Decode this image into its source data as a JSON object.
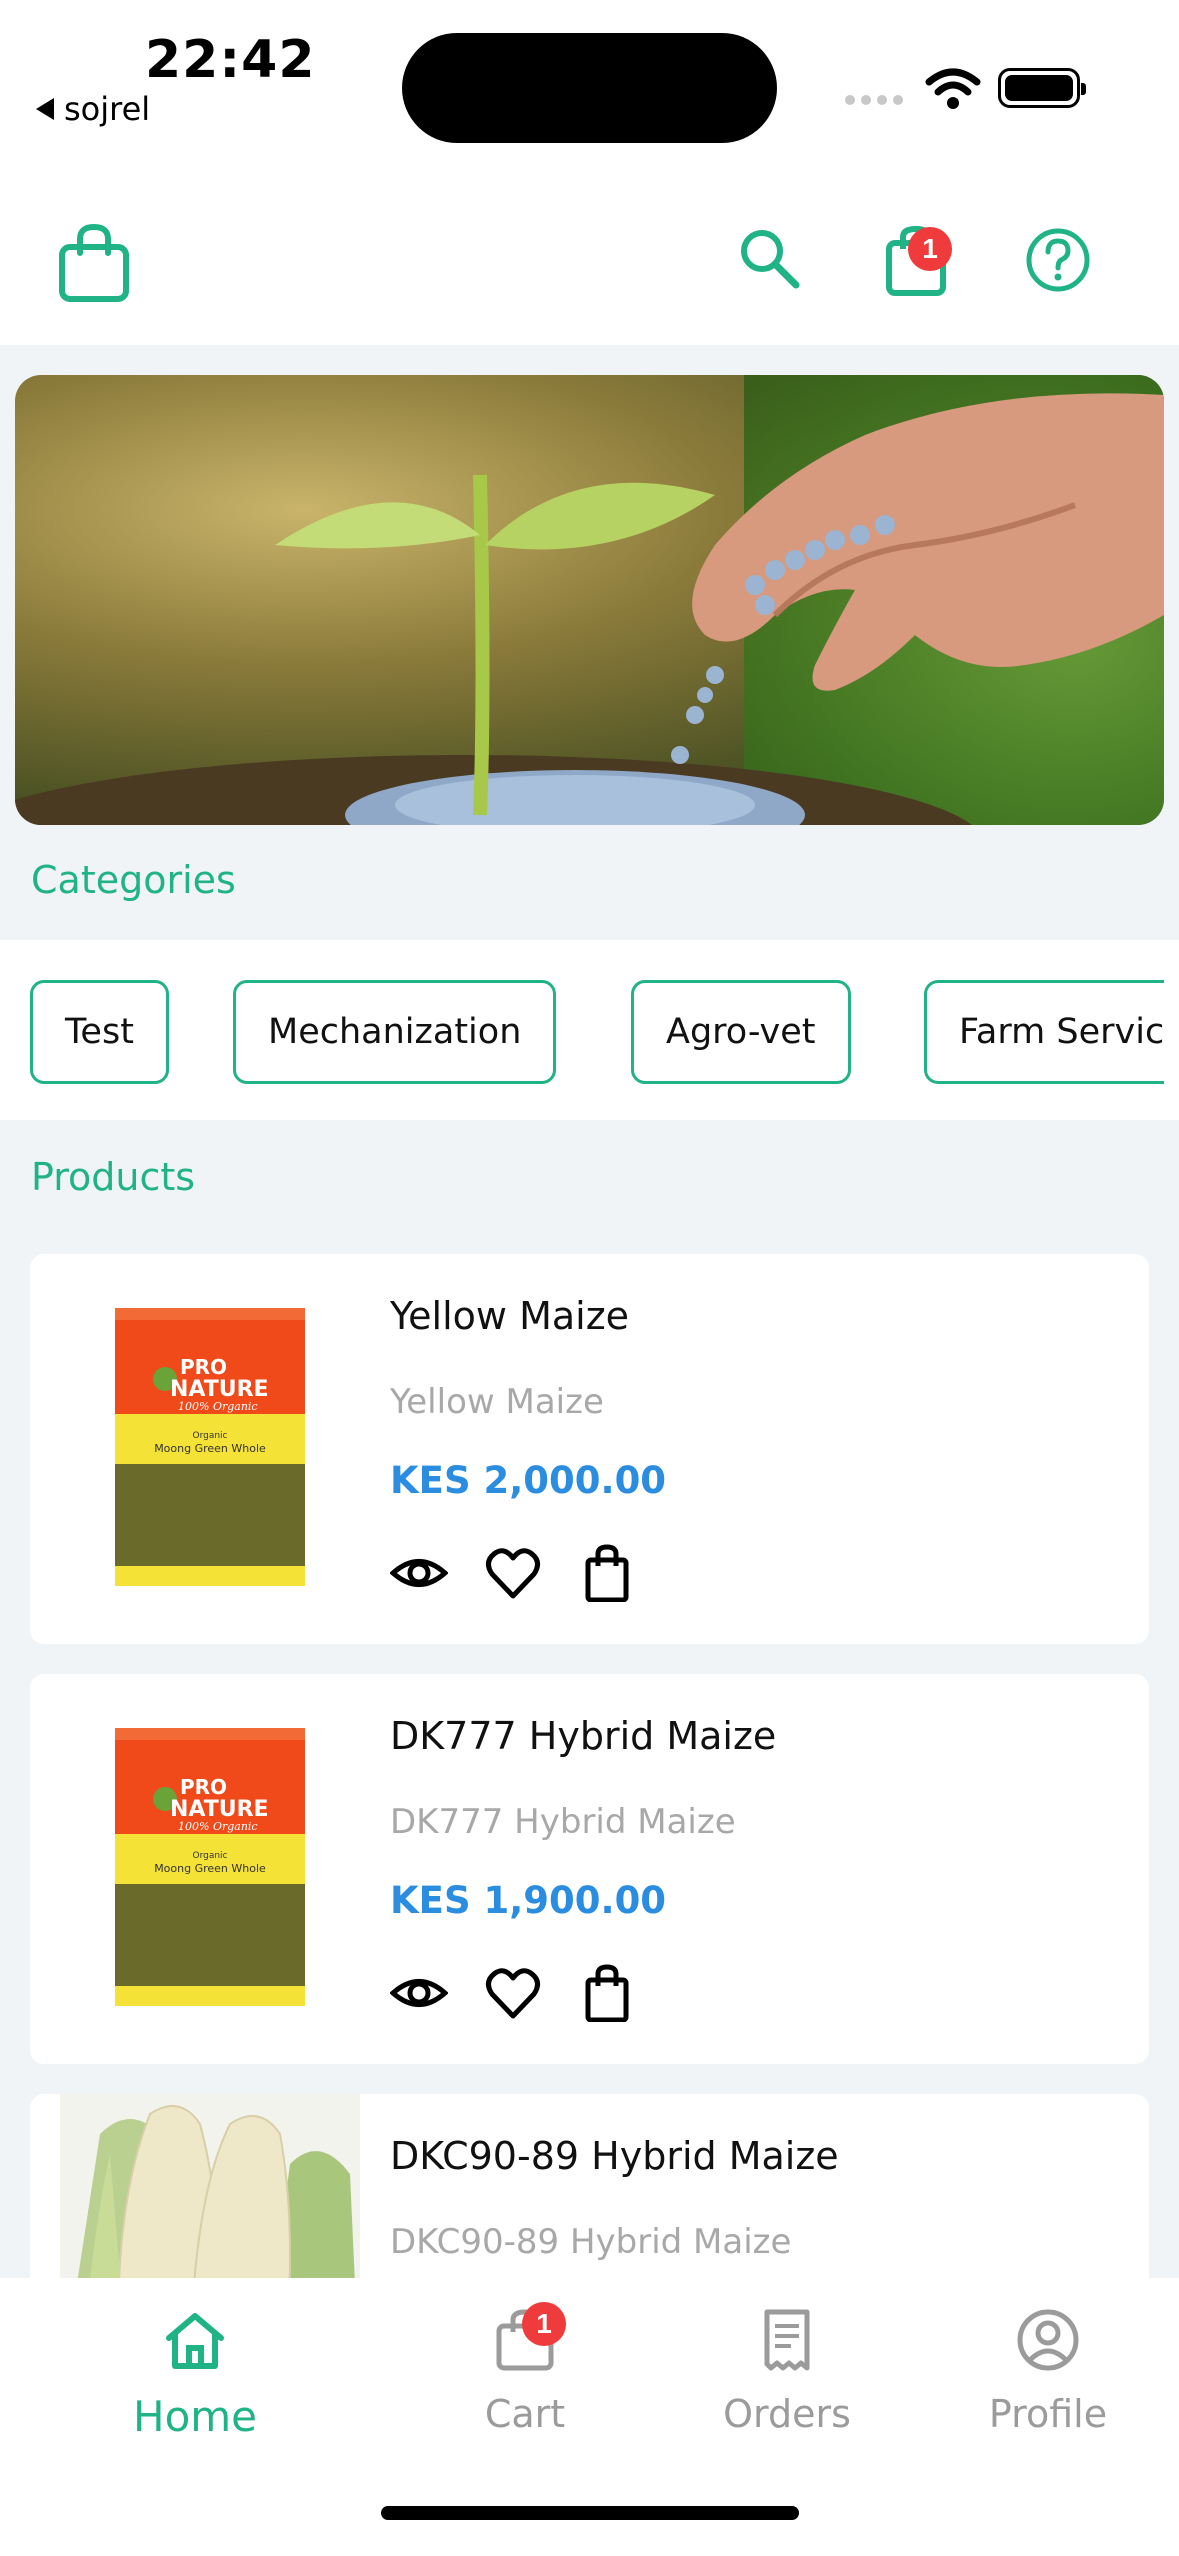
{
  "status_bar": {
    "time": "22:42",
    "back_app": "sojrel"
  },
  "header": {
    "cart_count": "1"
  },
  "categories": {
    "title": "Categories",
    "items": [
      "Test",
      "Mechanization",
      "Agro-vet",
      "Farm Servic"
    ]
  },
  "products": {
    "title": "Products",
    "items": [
      {
        "name": "Yellow Maize",
        "desc": "Yellow Maize",
        "price": "KES 2,000.00"
      },
      {
        "name": "DK777 Hybrid Maize",
        "desc": "DK777 Hybrid Maize",
        "price": "KES 1,900.00"
      },
      {
        "name": "DKC90-89 Hybrid Maize",
        "desc": "DKC90-89 Hybrid Maize",
        "price": ""
      }
    ],
    "packet_brand": [
      "PRO",
      "NATURE",
      "100% Organic"
    ],
    "packet_product": [
      "Organic",
      "Moong Green Whole"
    ]
  },
  "bottom_nav": {
    "items": [
      {
        "label": "Home",
        "icon": "home-icon"
      },
      {
        "label": "Cart",
        "icon": "cart-icon"
      },
      {
        "label": "Orders",
        "icon": "receipt-icon"
      },
      {
        "label": "Profile",
        "icon": "profile-icon"
      }
    ],
    "cart_count": "1"
  },
  "colors": {
    "accent": "#1fb386",
    "price": "#2a8de0",
    "badge": "#ef3b3b"
  }
}
